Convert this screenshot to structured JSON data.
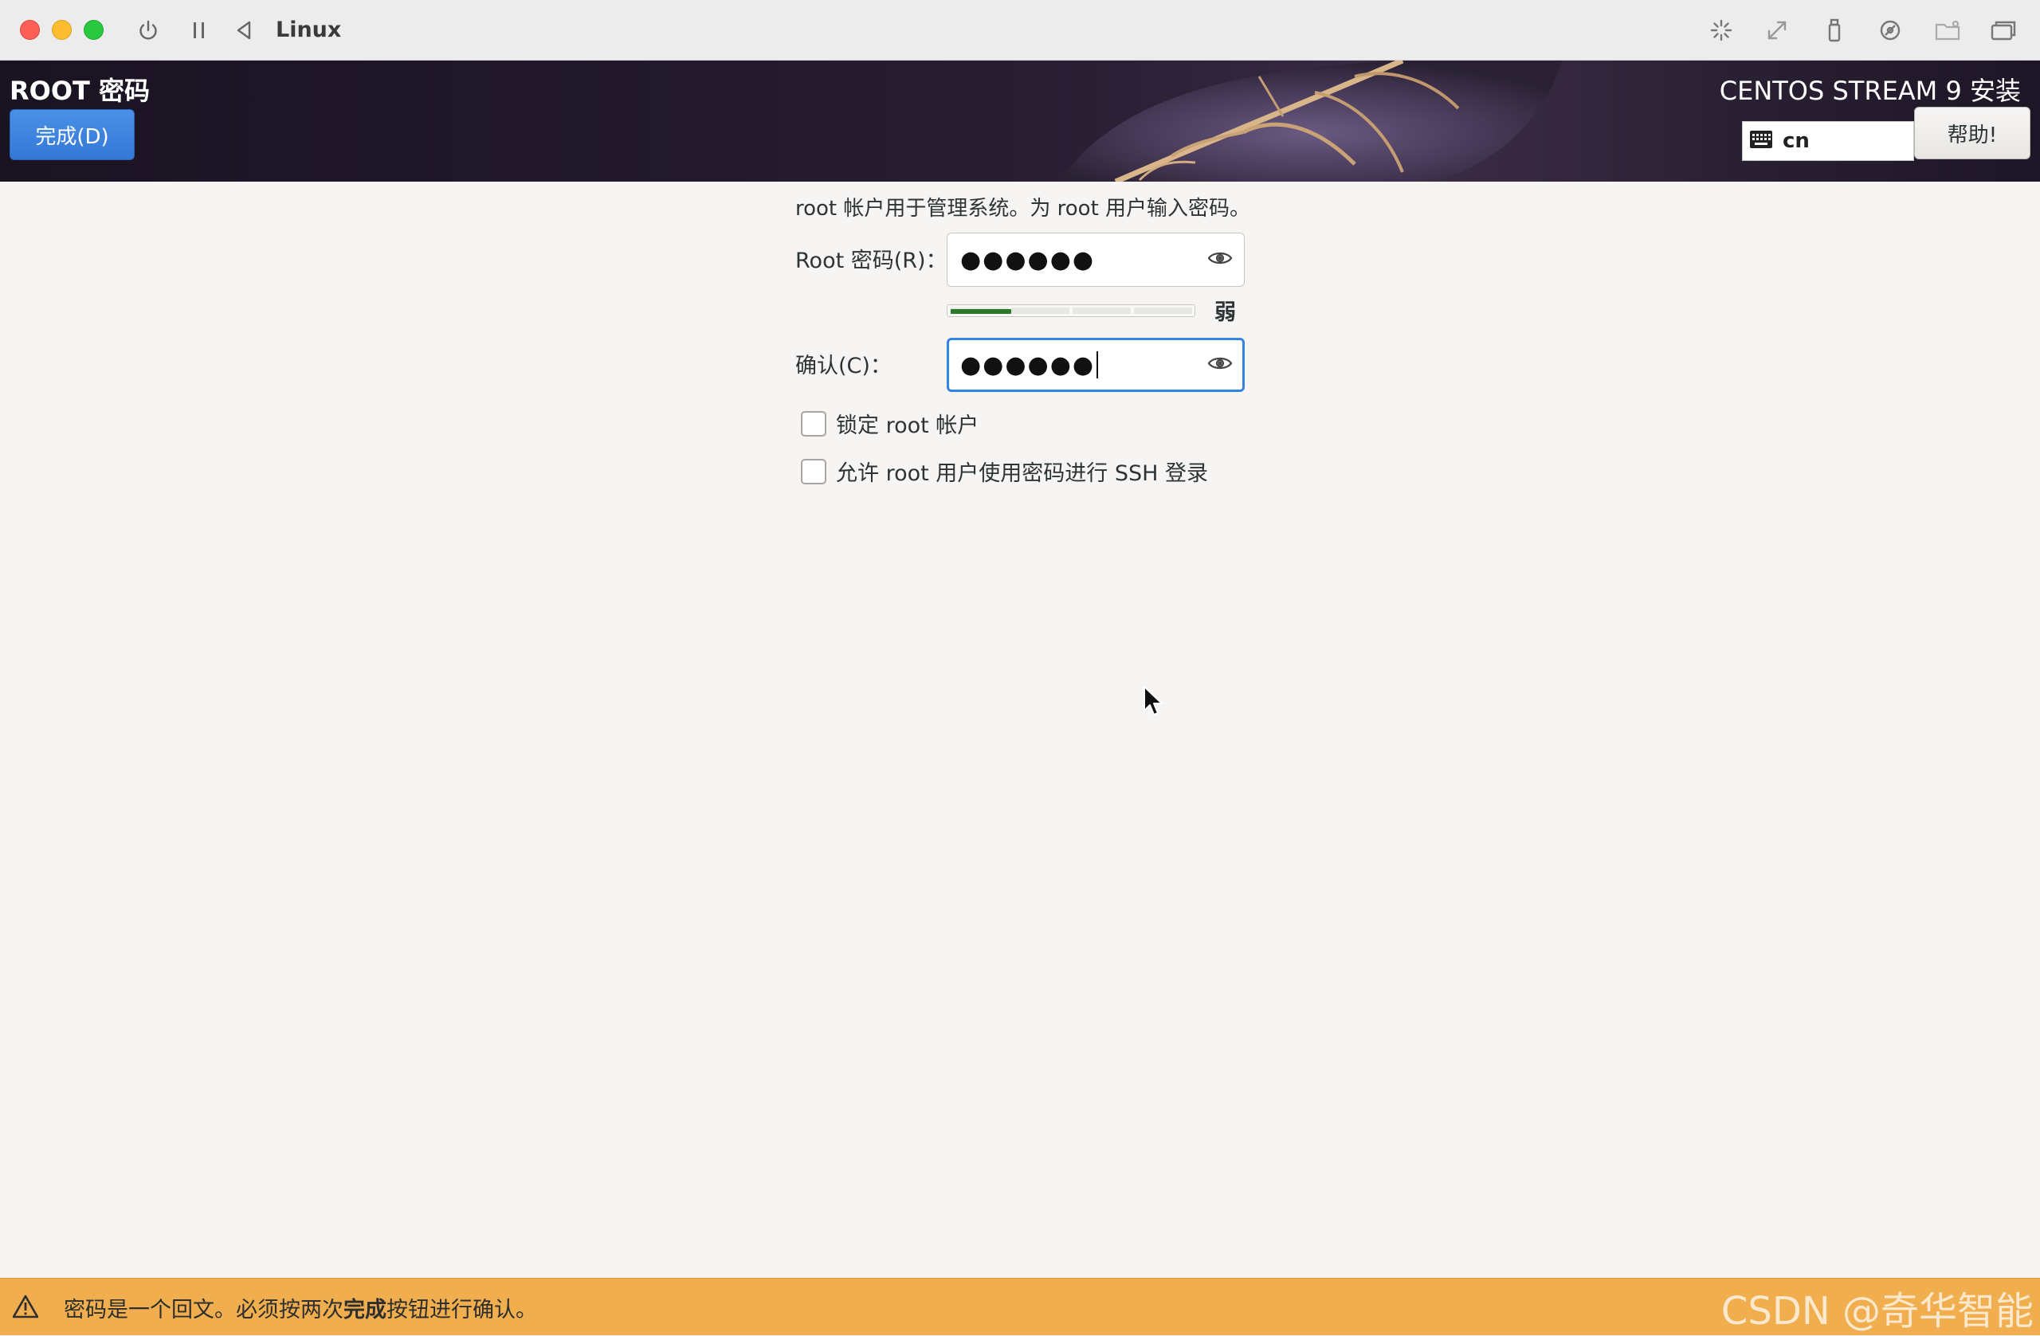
{
  "vm": {
    "title": "Linux",
    "toolbar_left_icons": [
      "power-icon",
      "pause-icon",
      "back-icon"
    ],
    "toolbar_right_icons": [
      "brightness-icon",
      "resize-icon",
      "usb-icon",
      "disc-icon",
      "shared-folder-icon",
      "windows-icon"
    ]
  },
  "header": {
    "spoke_title": "ROOT 密码",
    "done_label": "完成(D)",
    "product_title": "CENTOS STREAM 9 安装",
    "keyboard_layout": "cn",
    "help_label": "帮助!"
  },
  "form": {
    "description": "root 帐户用于管理系统。为 root 用户输入密码。",
    "root_password_label": "Root 密码(R)：",
    "root_password_value": "●●●●●●",
    "strength_label": "弱",
    "strength_level": 0.25,
    "confirm_label": "确认(C)：",
    "confirm_value": "●●●●●●",
    "lock_root_label": "锁定 root 帐户",
    "lock_root_checked": false,
    "allow_ssh_label": "允许 root 用户使用密码进行 SSH 登录",
    "allow_ssh_checked": false
  },
  "warning": {
    "text_before": "密码是一个回文。必须按两次",
    "text_bold": "完成",
    "text_after": "按钮进行确认。",
    "color": "#f0ae4e"
  },
  "watermark": "CSDN @奇华智能",
  "colors": {
    "accent": "#3584e4",
    "done_button": "#3a7fdc",
    "strength_weak": "#2a7a2a"
  }
}
